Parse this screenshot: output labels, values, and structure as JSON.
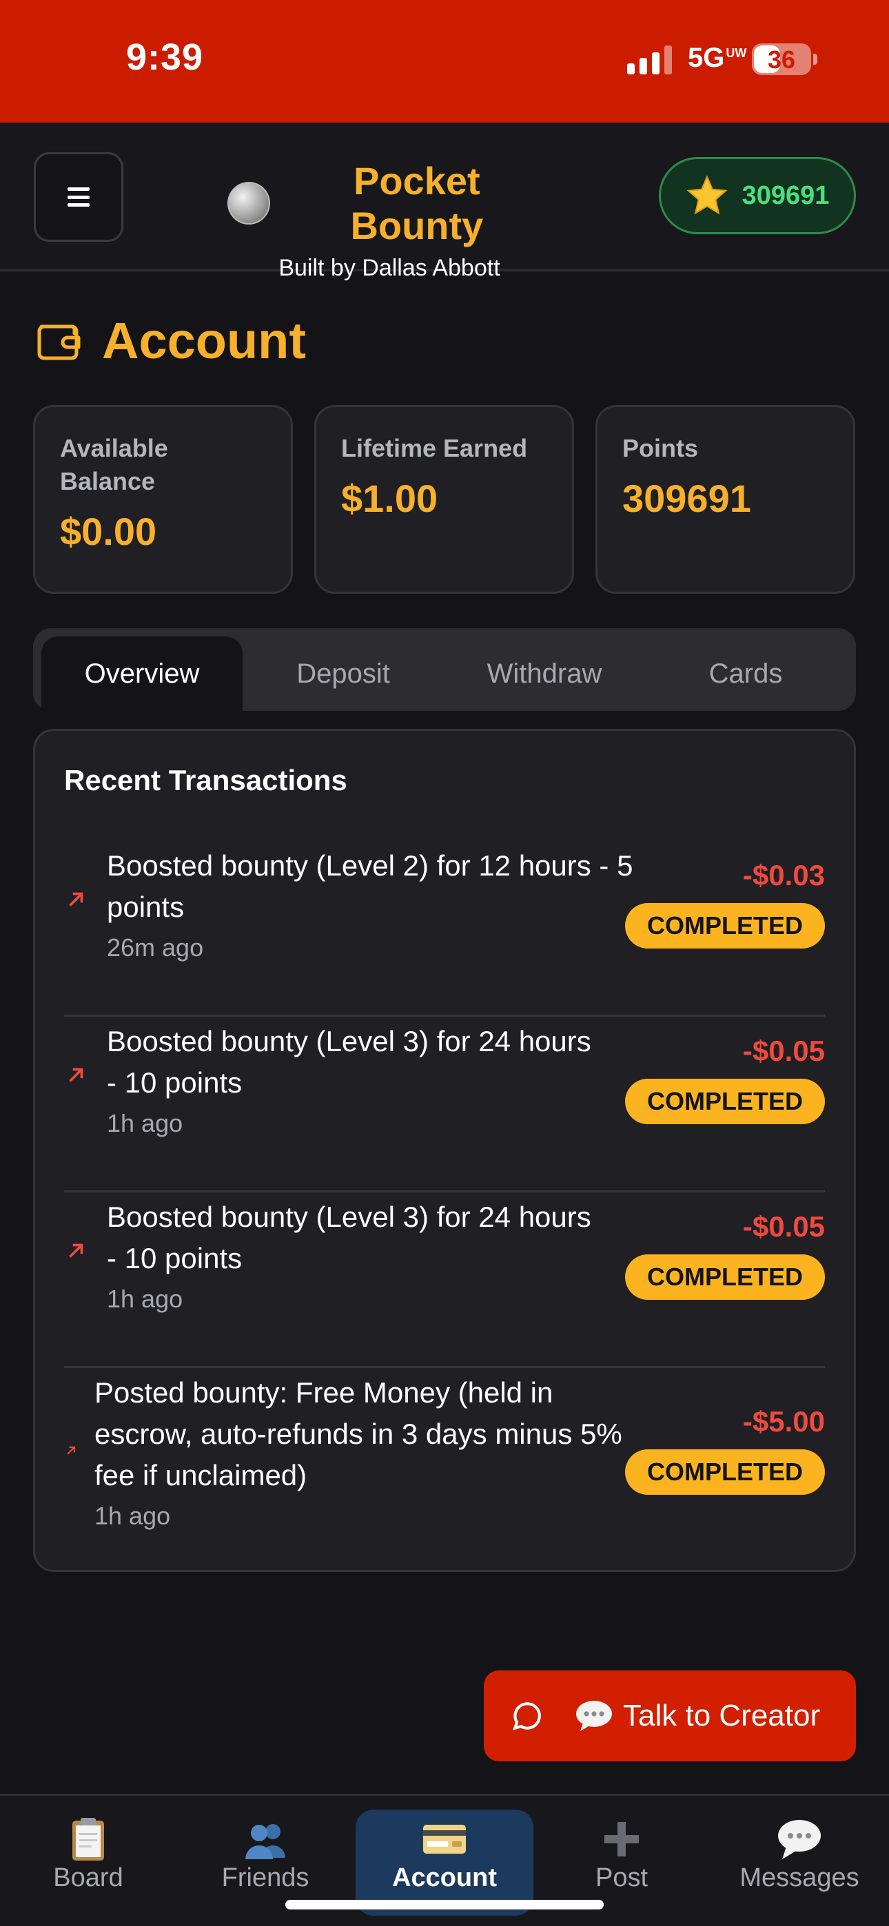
{
  "status_bar": {
    "time": "9:39",
    "network": "5G",
    "network_suffix": "UW",
    "battery": "36"
  },
  "header": {
    "menu_icon": "hamburger-menu-icon",
    "app_title": "Pocket Bounty",
    "subtitle": "Built by Dallas Abbott",
    "points_badge": "309691"
  },
  "page": {
    "title": "Account",
    "icon": "wallet-icon"
  },
  "stats": [
    {
      "label": "Available Balance",
      "value": "$0.00"
    },
    {
      "label": "Lifetime Earned",
      "value": "$1.00"
    },
    {
      "label": "Points",
      "value": "309691"
    }
  ],
  "tabs": [
    {
      "label": "Overview",
      "active": true
    },
    {
      "label": "Deposit",
      "active": false
    },
    {
      "label": "Withdraw",
      "active": false
    },
    {
      "label": "Cards",
      "active": false
    }
  ],
  "transactions": {
    "heading": "Recent Transactions",
    "items": [
      {
        "description": "Boosted bounty (Level 2) for 12 hours - 5 points",
        "time": "26m ago",
        "amount": "-$0.03",
        "status": "COMPLETED"
      },
      {
        "description": "Boosted bounty (Level 3) for 24 hours - 10 points",
        "time": "1h ago",
        "amount": "-$0.05",
        "status": "COMPLETED"
      },
      {
        "description": "Boosted bounty (Level 3) for 24 hours - 10 points",
        "time": "1h ago",
        "amount": "-$0.05",
        "status": "COMPLETED"
      },
      {
        "description": "Posted bounty: Free Money (held in escrow, auto-refunds in 3 days minus 5% fee if unclaimed)",
        "time": "1h ago",
        "amount": "-$5.00",
        "status": "COMPLETED"
      }
    ]
  },
  "fab": {
    "label": "Talk to Creator"
  },
  "bottom_nav": [
    {
      "label": "Board",
      "icon": "clipboard-icon",
      "active": false
    },
    {
      "label": "Friends",
      "icon": "people-icon",
      "active": false
    },
    {
      "label": "Account",
      "icon": "credit-card-icon",
      "active": true
    },
    {
      "label": "Post",
      "icon": "plus-icon",
      "active": false
    },
    {
      "label": "Messages",
      "icon": "speech-bubble-icon",
      "active": false
    }
  ],
  "colors": {
    "accent": "#f7b02c",
    "status_bar": "#cc1c00",
    "negative": "#f04a3e",
    "badge": "#fbb41f",
    "points_green": "#4ade80",
    "nav_active": "#1c3a5e"
  }
}
